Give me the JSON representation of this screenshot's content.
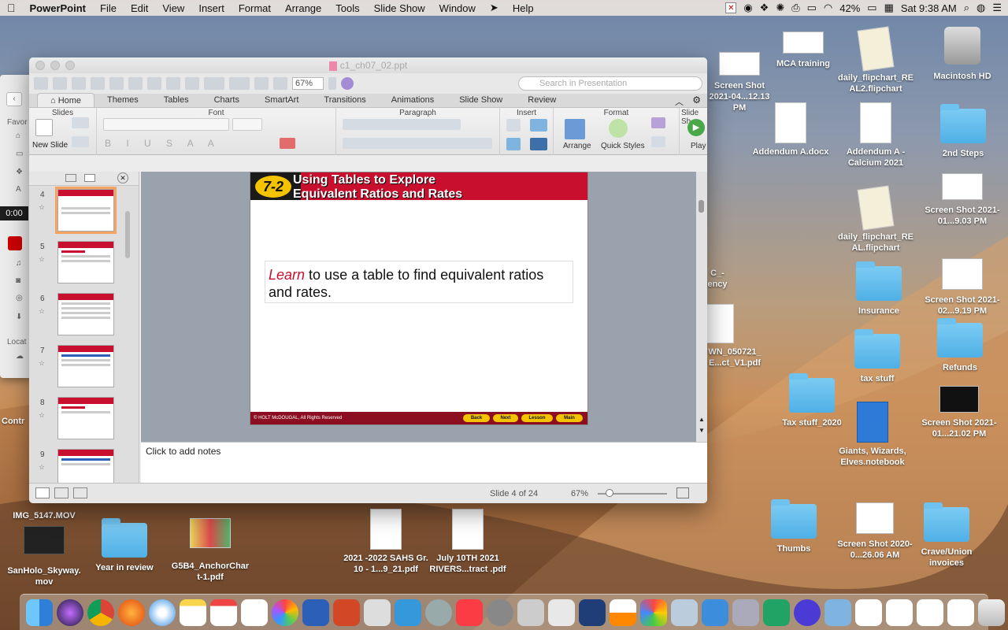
{
  "menubar": {
    "app": "PowerPoint",
    "items": [
      "File",
      "Edit",
      "View",
      "Insert",
      "Format",
      "Arrange",
      "Tools",
      "Slide Show",
      "Window",
      "Help"
    ],
    "battery": "42%",
    "clock": "Sat 9:38 AM"
  },
  "window": {
    "title": "c1_ch07_02.ppt",
    "zoom": "67%",
    "search_placeholder": "Search in Presentation"
  },
  "ribbon": {
    "tabs": [
      "Home",
      "Themes",
      "Tables",
      "Charts",
      "SmartArt",
      "Transitions",
      "Animations",
      "Slide Show",
      "Review"
    ],
    "groups": {
      "slides": "Slides",
      "font": "Font",
      "paragraph": "Paragraph",
      "insert": "Insert",
      "format": "Format",
      "slideshow": "Slide Sh"
    },
    "new_slide": "New Slide",
    "arrange": "Arrange",
    "quick_styles": "Quick Styles",
    "play": "Play"
  },
  "thumbs": [
    "4",
    "5",
    "6",
    "7",
    "8",
    "9"
  ],
  "slide": {
    "badge": "7-2",
    "title_line1": "Using Tables to Explore",
    "title_line2": "Equivalent Ratios and Rates",
    "learn_word": "Learn",
    "learn_rest": " to use a table to find equivalent ratios and rates.",
    "footer": "© HOLT McDOUGAL, All Rights Reserved",
    "nav": [
      "Back",
      "Next",
      "Lesson",
      "Main"
    ]
  },
  "notes_placeholder": "Click to add notes",
  "status": {
    "slide_info": "Slide 4 of 24",
    "zoom": "67%"
  },
  "sidebar": {
    "favorites": "Favor",
    "locations": "Locat",
    "timer": "0:00",
    "partial_label": "Contr"
  },
  "desktop_icons": {
    "mca": "MCA training",
    "flip_re2": "daily_flipchart_RE AL2.flipchart",
    "hd": "Macintosh HD",
    "shot_top": "Screen Shot 2021-04...12.13 PM",
    "addendumA": "Addendum A.docx",
    "addendumCalc": "Addendum A - Calcium 2021",
    "steps": "2nd Steps",
    "flip_re": "daily_flipchart_RE AL.flipchart",
    "shot_903": "Screen Shot 2021-01...9.03 PM",
    "cut_ency": "C_- ency",
    "insurance": "Insurance",
    "shot_919": "Screen Shot 2021-02...9.19 PM",
    "wn_pdf": "WN_050721_ E...ct_V1.pdf",
    "taxstuff": "tax stuff",
    "refunds": "Refunds",
    "tax2020": "Tax stuff_2020",
    "giants": "Giants, Wizards, Elves.notebook",
    "shot_2102": "Screen Shot 2021-01...21.02 PM",
    "img_mov": "IMG_5147.MOV",
    "sanholo": "SanHolo_Skyway. mov",
    "yearreview": "Year in review",
    "anchor": "G5B4_AnchorChar t-1.pdf",
    "sahs": "2021 -2022 SAHS Gr. 10 - 1...9_21.pdf",
    "july": "July 10TH 2021 RIVERS...tract .pdf",
    "thumbs": "Thumbs",
    "shot_2606": "Screen Shot 2020-0...26.06 AM",
    "crave": "Crave/Union invoices"
  },
  "colors": {
    "accent": "#c8102e",
    "badge": "#f4c300"
  }
}
